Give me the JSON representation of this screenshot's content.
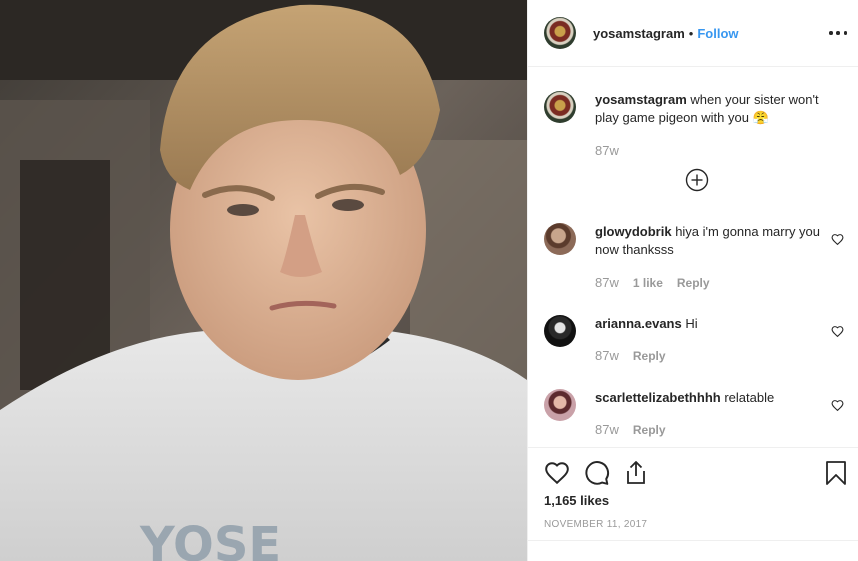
{
  "post": {
    "photo_icon": "photo-of-boy",
    "photo_text": "YOSE"
  },
  "header": {
    "username": "yosamstagram",
    "separator": "•",
    "follow_label": "Follow",
    "more_icon": "more-options-icon"
  },
  "caption": {
    "username": "yosamstagram",
    "text": "when your sister won't play game pigeon with you 😤",
    "time": "87w"
  },
  "load_more_icon": "plus-circle-icon",
  "comments": [
    {
      "username": "glowydobrik",
      "text": "hiya i'm gonna marry you now thanksss",
      "time": "87w",
      "likes": "1 like",
      "reply": "Reply"
    },
    {
      "username": "arianna.evans",
      "text": "Hi",
      "time": "87w",
      "reply": "Reply"
    },
    {
      "username": "scarlettelizabethhhh",
      "text": "relatable",
      "time": "87w",
      "reply": "Reply"
    }
  ],
  "actions": {
    "like_icon": "heart-icon",
    "comment_icon": "comment-icon",
    "share_icon": "share-icon",
    "save_icon": "bookmark-icon"
  },
  "likes": "1,165 likes",
  "date": "NOVEMBER 11, 2017",
  "colors": {
    "link": "#3897f0",
    "text": "#262626",
    "muted": "#999999",
    "border": "#efefef"
  }
}
